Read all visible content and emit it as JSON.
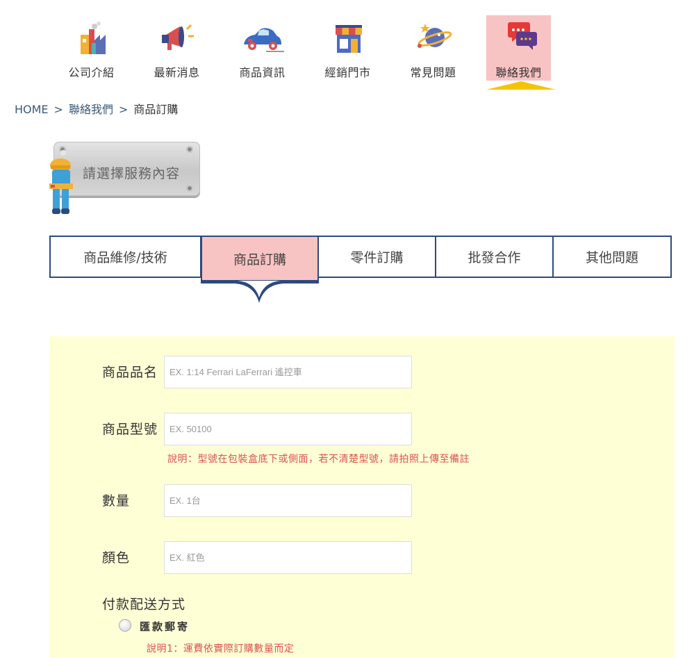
{
  "nav": {
    "items": [
      {
        "label": "公司介紹",
        "icon": "factory-icon"
      },
      {
        "label": "最新消息",
        "icon": "megaphone-icon"
      },
      {
        "label": "商品資訊",
        "icon": "car-icon"
      },
      {
        "label": "經銷門市",
        "icon": "store-icon"
      },
      {
        "label": "常見問題",
        "icon": "planet-icon"
      },
      {
        "label": "聯絡我們",
        "icon": "chat-bubbles-icon",
        "active": true
      }
    ]
  },
  "breadcrumb": {
    "items": [
      "HOME",
      "聯絡我們",
      "商品訂購"
    ],
    "separator": ">"
  },
  "sign": {
    "text": "請選擇服務內容"
  },
  "tabs": [
    {
      "label": "商品維修/技術"
    },
    {
      "label": "商品訂購",
      "active": true
    },
    {
      "label": "零件訂購"
    },
    {
      "label": "批發合作"
    },
    {
      "label": "其他問題"
    }
  ],
  "form": {
    "fields": [
      {
        "label": "商品品名",
        "placeholder": "EX. 1:14 Ferrari LaFerrari 遙控車"
      },
      {
        "label": "商品型號",
        "placeholder": "EX. 50100",
        "note": "說明：型號在包裝盒底下或側面，若不清楚型號，請拍照上傳至備註"
      },
      {
        "label": "數量",
        "placeholder": "EX. 1台"
      },
      {
        "label": "顏色",
        "placeholder": "EX. 紅色"
      }
    ],
    "payment": {
      "title": "付款配送方式",
      "option": "匯款郵寄",
      "note": "說明1：運費依實際訂購數量而定"
    }
  },
  "colors": {
    "active_tab_bg": "#f8c3c3",
    "tab_border": "#2c4a7c",
    "form_bg": "#ffffd6",
    "note_red": "#d9534f",
    "nav_arrow": "#f5c400"
  }
}
